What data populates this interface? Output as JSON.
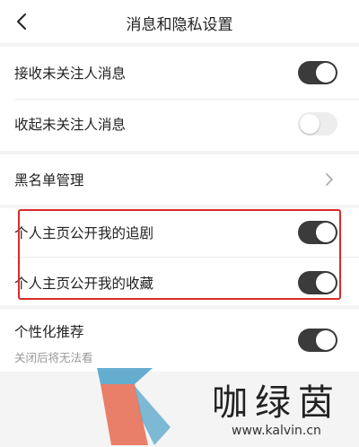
{
  "header": {
    "title": "消息和隐私设置",
    "back_icon": "chevron-left-icon"
  },
  "settings": [
    {
      "label": "接收未关注人消息",
      "control": "toggle",
      "on": true
    },
    {
      "label": "收起未关注人消息",
      "control": "toggle",
      "on": false
    },
    {
      "label": "黑名单管理",
      "control": "chevron",
      "icon": "chevron-right-icon"
    },
    {
      "label": "个人主页公开我的追剧",
      "control": "toggle",
      "on": true
    },
    {
      "label": "个人主页公开我的收藏",
      "control": "toggle",
      "on": true
    },
    {
      "label": "个性化推荐",
      "sublabel": "关闭后将无法看",
      "control": "toggle",
      "on": true
    }
  ],
  "watermark": {
    "text": "咖绿茵",
    "url": "www.kalvin.cn"
  },
  "colors": {
    "toggle_on": "#3b3b3b",
    "toggle_off": "#ededed",
    "highlight_border": "#d92b2b"
  }
}
